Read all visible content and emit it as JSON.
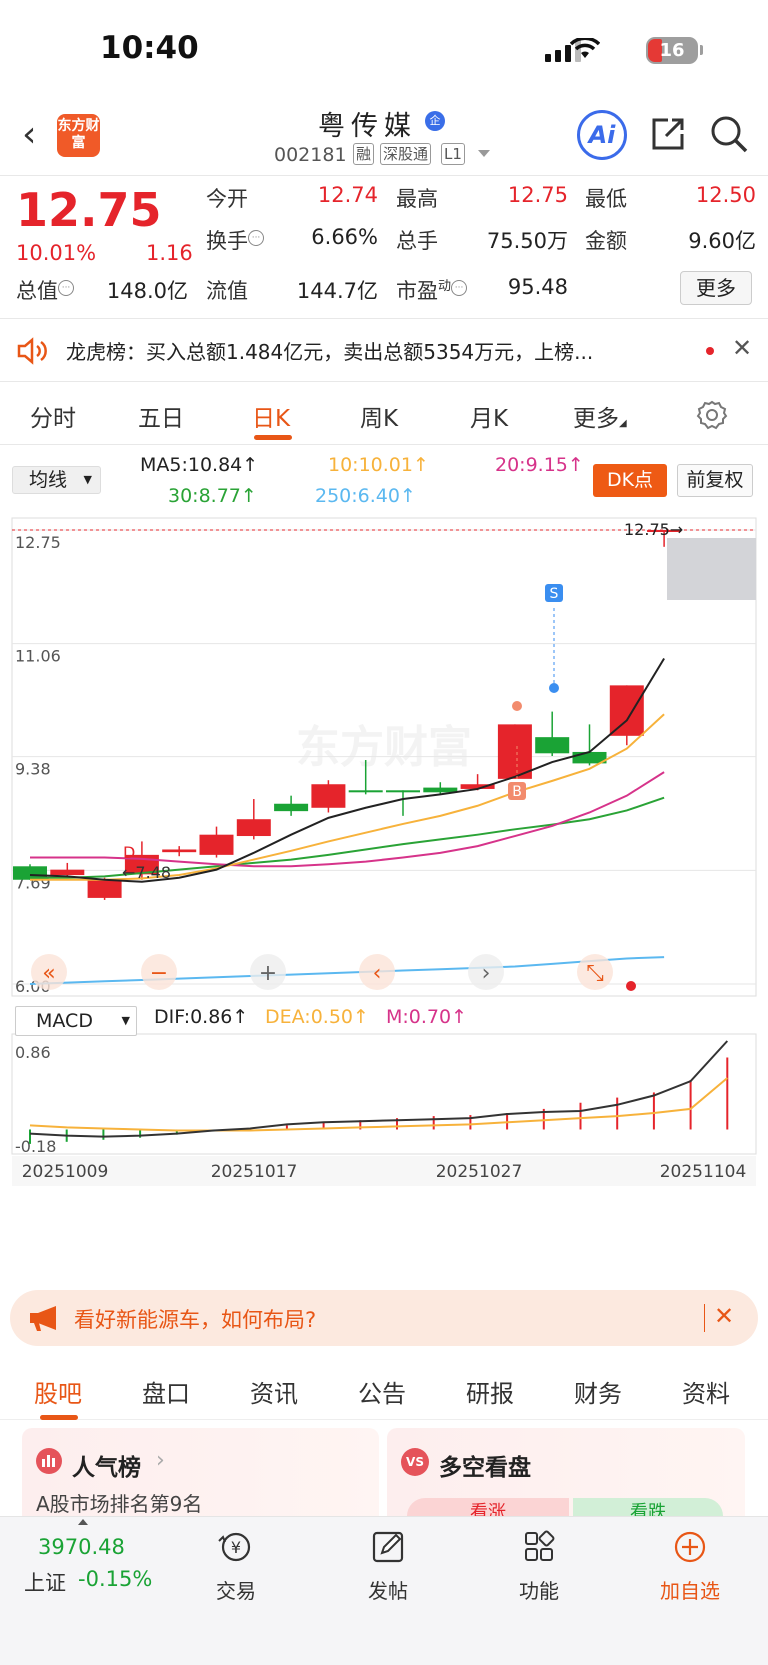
{
  "status_bar": {
    "time": "10:40",
    "battery": "16"
  },
  "header": {
    "logo_text": "东方财富",
    "stock_name": "粤传媒",
    "qi_badge": "企",
    "code": "002181",
    "tags": [
      "融",
      "深股通",
      "L1"
    ],
    "ai_label": "Ai"
  },
  "quote": {
    "price": "12.75",
    "change_pct": "10.01%",
    "change": "1.16",
    "labels": {
      "open": "今开",
      "high": "最高",
      "low": "最低",
      "turnover": "换手",
      "volume": "总手",
      "amount": "金额",
      "mktcap": "总值",
      "float_cap": "流值",
      "pe": "市盈"
    },
    "pe_superscript": "动",
    "values": {
      "open": "12.74",
      "high": "12.75",
      "low": "12.50",
      "turnover": "6.66%",
      "volume": "75.50万",
      "amount": "9.60亿",
      "mktcap": "148.0亿",
      "float_cap": "144.7亿",
      "pe": "95.48"
    },
    "more_button": "更多"
  },
  "dragon_tiger": {
    "text": "龙虎榜：买入总额1.484亿元，卖出总额5354万元，上榜..."
  },
  "period_tabs": [
    "分时",
    "五日",
    "日K",
    "周K",
    "月K",
    "更多"
  ],
  "active_period": "日K",
  "ma_bar": {
    "selector": "均线",
    "ma5": "MA5:10.84↑",
    "ma10": "10:10.01↑",
    "ma20": "20:9.15↑",
    "ma30": "30:8.77↑",
    "ma250": "250:6.40↑",
    "dk_button": "DK点",
    "adjust_button": "前复权"
  },
  "colors": {
    "up": "#e5242b",
    "down": "#1aa335",
    "ma5": "#222222",
    "ma10": "#f7b23b",
    "ma20": "#d6338a",
    "ma30": "#2aa336",
    "ma250": "#5bb8f0",
    "accent": "#e85616"
  },
  "chart_data": {
    "type": "candlestick",
    "y_ticks": [
      "12.75",
      "11.06",
      "9.38",
      "7.69",
      "6.00"
    ],
    "ylim": [
      6.0,
      12.75
    ],
    "candles": [
      {
        "o": 7.55,
        "c": 7.75,
        "h": 7.78,
        "l": 7.55,
        "up": false
      },
      {
        "o": 7.7,
        "c": 7.62,
        "h": 7.8,
        "l": 7.58,
        "up": true
      },
      {
        "o": 7.55,
        "c": 7.28,
        "h": 7.58,
        "l": 7.25,
        "up": true
      },
      {
        "o": 7.63,
        "c": 7.92,
        "h": 8.12,
        "l": 7.55,
        "up": true
      },
      {
        "o": 7.96,
        "c": 8.0,
        "h": 8.05,
        "l": 7.9,
        "up": true
      },
      {
        "o": 7.92,
        "c": 8.22,
        "h": 8.34,
        "l": 7.88,
        "up": true
      },
      {
        "o": 8.2,
        "c": 8.45,
        "h": 8.75,
        "l": 8.15,
        "up": true
      },
      {
        "o": 8.68,
        "c": 8.57,
        "h": 8.8,
        "l": 8.5,
        "up": false
      },
      {
        "o": 8.62,
        "c": 8.97,
        "h": 9.03,
        "l": 8.55,
        "up": true
      },
      {
        "o": 8.88,
        "c": 8.85,
        "h": 9.33,
        "l": 8.82,
        "up": false
      },
      {
        "o": 8.88,
        "c": 8.85,
        "h": 8.88,
        "l": 8.5,
        "up": false
      },
      {
        "o": 8.92,
        "c": 8.85,
        "h": 9.0,
        "l": 8.82,
        "up": false
      },
      {
        "o": 8.9,
        "c": 8.97,
        "h": 9.12,
        "l": 8.88,
        "up": true
      },
      {
        "o": 9.05,
        "c": 9.86,
        "h": 9.86,
        "l": 9.05,
        "up": true
      },
      {
        "o": 9.67,
        "c": 9.43,
        "h": 10.05,
        "l": 9.39,
        "up": false
      },
      {
        "o": 9.45,
        "c": 9.28,
        "h": 9.86,
        "l": 9.25,
        "up": false
      },
      {
        "o": 9.69,
        "c": 10.44,
        "h": 10.44,
        "l": 9.55,
        "up": true
      },
      {
        "o": 12.74,
        "c": 12.75,
        "h": 12.75,
        "l": 12.5,
        "up": true
      }
    ],
    "ma5": [
      7.62,
      7.6,
      7.55,
      7.52,
      7.58,
      7.7,
      7.95,
      8.22,
      8.47,
      8.62,
      8.75,
      8.82,
      8.9,
      9.08,
      9.3,
      9.45,
      9.92,
      10.84
    ],
    "ma10": [
      7.55,
      7.55,
      7.55,
      7.57,
      7.62,
      7.72,
      7.85,
      7.98,
      8.12,
      8.25,
      8.38,
      8.5,
      8.65,
      8.85,
      9.02,
      9.2,
      9.5,
      10.01
    ],
    "ma20": [
      7.88,
      7.88,
      7.88,
      7.86,
      7.82,
      7.78,
      7.75,
      7.75,
      7.78,
      7.82,
      7.88,
      7.95,
      8.05,
      8.2,
      8.35,
      8.55,
      8.8,
      9.15
    ],
    "ma30": [
      7.58,
      7.58,
      7.6,
      7.65,
      7.7,
      7.75,
      7.8,
      7.85,
      7.92,
      8.0,
      8.08,
      8.15,
      8.22,
      8.3,
      8.37,
      8.45,
      8.58,
      8.77
    ],
    "ma250": [
      6.0,
      6.02,
      6.04,
      6.06,
      6.08,
      6.1,
      6.12,
      6.14,
      6.16,
      6.18,
      6.2,
      6.22,
      6.24,
      6.26,
      6.3,
      6.34,
      6.38,
      6.4
    ],
    "annotations": {
      "low_label": "←7.48",
      "high_label": "12.75→",
      "sell_marker": "S",
      "buy_marker": "B",
      "d_marker": "D"
    },
    "macd": {
      "selector": "MACD",
      "dif_label": "DIF:0.86↑",
      "dea_label": "DEA:0.50↑",
      "m_label": "M:0.70↑",
      "y_ticks": [
        "0.86",
        "-0.18"
      ],
      "ylim": [
        -0.18,
        0.86
      ],
      "dif": [
        -0.04,
        -0.06,
        -0.07,
        -0.06,
        -0.04,
        -0.01,
        0.01,
        0.05,
        0.07,
        0.08,
        0.09,
        0.1,
        0.11,
        0.15,
        0.17,
        0.18,
        0.24,
        0.33,
        0.47,
        0.86
      ],
      "dea": [
        0.04,
        0.02,
        0.01,
        0.0,
        -0.01,
        -0.01,
        -0.01,
        0.0,
        0.01,
        0.02,
        0.03,
        0.04,
        0.05,
        0.07,
        0.09,
        0.11,
        0.13,
        0.16,
        0.2,
        0.5
      ],
      "hist": [
        -0.14,
        -0.12,
        -0.1,
        -0.08,
        -0.05,
        -0.02,
        0.01,
        0.04,
        0.07,
        0.09,
        0.11,
        0.13,
        0.14,
        0.16,
        0.2,
        0.26,
        0.31,
        0.36,
        0.48,
        0.7
      ]
    },
    "x_labels": [
      "20251009",
      "20251017",
      "20251027",
      "20251104"
    ]
  },
  "chart_controls": [
    "«",
    "−",
    "+",
    "‹",
    "›",
    "⤡"
  ],
  "hint_banner": {
    "text": "看好新能源车，如何布局?"
  },
  "sub_tabs": [
    "股吧",
    "盘口",
    "资讯",
    "公告",
    "研报",
    "财务",
    "资料"
  ],
  "active_sub_tab": "股吧",
  "cards": {
    "popularity": {
      "title": "人气榜",
      "sub": "A股市场排名第9名"
    },
    "bullbear": {
      "title": "多空看盘",
      "up": "看涨",
      "down": "看跌",
      "vs": "VS"
    }
  },
  "tab_bar": {
    "index_value": "3970.48",
    "index_name": "上证",
    "index_change": "-0.15%",
    "items": [
      "交易",
      "发帖",
      "功能",
      "加自选"
    ]
  }
}
